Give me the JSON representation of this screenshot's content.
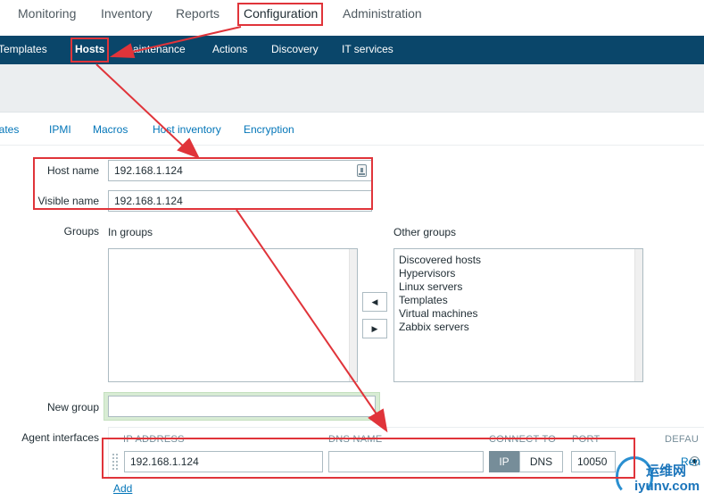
{
  "topnav": {
    "items": [
      "Monitoring",
      "Inventory",
      "Reports",
      "Configuration",
      "Administration"
    ]
  },
  "subnav": {
    "items": [
      "Templates",
      "Hosts",
      "aintenance",
      "Actions",
      "Discovery",
      "IT services"
    ]
  },
  "tabs": [
    "lates",
    "IPMI",
    "Macros",
    "Host inventory",
    "Encryption"
  ],
  "form": {
    "host_name_label": "Host name",
    "host_name_value": "192.168.1.124",
    "visible_name_label": "Visible name",
    "visible_name_value": "192.168.1.124",
    "groups_label": "Groups",
    "in_groups_label": "In groups",
    "other_groups_label": "Other groups",
    "other_groups": [
      "Discovered hosts",
      "Hypervisors",
      "Linux servers",
      "Templates",
      "Virtual machines",
      "Zabbix servers"
    ],
    "move_left": "◀",
    "move_right": "▶",
    "new_group_label": "New group",
    "new_group_value": "",
    "agent_interfaces_label": "Agent interfaces",
    "col_ip": "IP ADDRESS",
    "col_dns": "DNS NAME",
    "col_connect": "CONNECT TO",
    "col_port": "PORT",
    "col_default": "DEFAU",
    "ip_value": "192.168.1.124",
    "dns_value": "",
    "ip_button": "IP",
    "dns_button": "DNS",
    "port_value": "10050",
    "default_radio_label": "Ren",
    "add_link": "Add"
  },
  "watermark": {
    "top_text": "运维网",
    "bottom_text": "iyunv.com"
  },
  "colors": {
    "subnav_bg": "#0a466a",
    "link": "#0275b8",
    "annotation_red": "#e0343a",
    "active_ip_bg": "#768d99"
  }
}
